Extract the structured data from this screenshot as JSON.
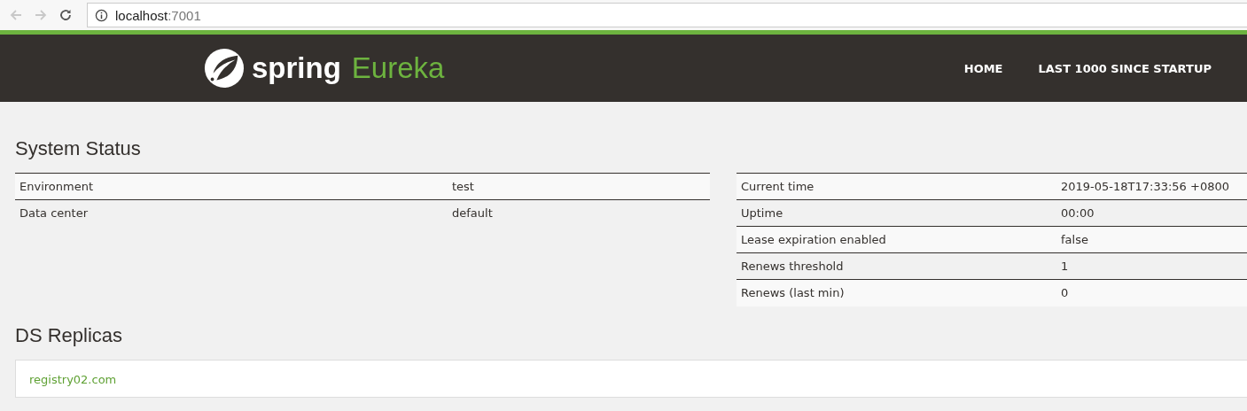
{
  "browser": {
    "url_host": "localhost",
    "url_port": ":7001"
  },
  "header": {
    "brand": "spring",
    "product": "Eureka",
    "nav": [
      {
        "label": "HOME"
      },
      {
        "label": "LAST 1000 SINCE STARTUP"
      }
    ]
  },
  "system_status": {
    "title": "System Status",
    "left_table": [
      {
        "name": "Environment",
        "value": "test"
      },
      {
        "name": "Data center",
        "value": "default"
      }
    ],
    "right_table": [
      {
        "name": "Current time",
        "value": "2019-05-18T17:33:56 +0800"
      },
      {
        "name": "Uptime",
        "value": "00:00"
      },
      {
        "name": "Lease expiration enabled",
        "value": "false"
      },
      {
        "name": "Renews threshold",
        "value": "1"
      },
      {
        "name": "Renews (last min)",
        "value": "0"
      }
    ]
  },
  "ds_replicas": {
    "title": "DS Replicas",
    "items": [
      "registry02.com"
    ]
  }
}
